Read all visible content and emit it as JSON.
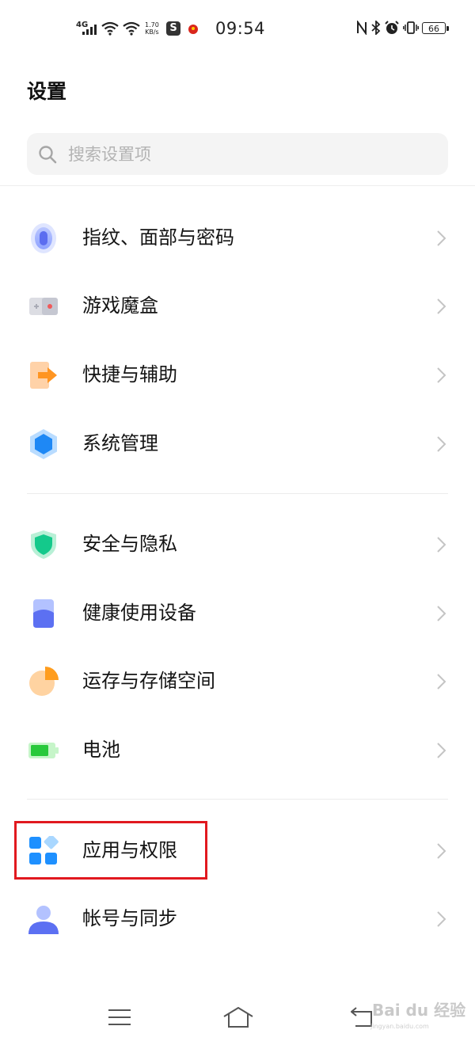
{
  "status_bar": {
    "network": "4G",
    "speed_value": "1.70",
    "speed_unit": "KB/s",
    "time": "09:54",
    "battery": "66"
  },
  "header": {
    "title": "设置",
    "search_placeholder": "搜索设置项"
  },
  "groups": [
    {
      "items": [
        {
          "label": "指纹、面部与密码",
          "icon": "fingerprint-icon"
        },
        {
          "label": "游戏魔盒",
          "icon": "game-box-icon"
        },
        {
          "label": "快捷与辅助",
          "icon": "shortcut-icon"
        },
        {
          "label": "系统管理",
          "icon": "system-management-icon"
        }
      ]
    },
    {
      "items": [
        {
          "label": "安全与隐私",
          "icon": "shield-icon"
        },
        {
          "label": "健康使用设备",
          "icon": "health-usage-icon"
        },
        {
          "label": "运存与存储空间",
          "icon": "storage-pie-icon"
        },
        {
          "label": "电池",
          "icon": "battery-icon"
        }
      ]
    },
    {
      "items": [
        {
          "label": "应用与权限",
          "icon": "apps-icon",
          "highlighted": true
        },
        {
          "label": "帐号与同步",
          "icon": "account-icon"
        }
      ]
    }
  ],
  "watermark": {
    "text": "Bai du 经验",
    "sub": "jingyan.baidu.com"
  },
  "colors": {
    "highlight_border": "#e1191f",
    "search_bg": "#f4f4f4"
  }
}
